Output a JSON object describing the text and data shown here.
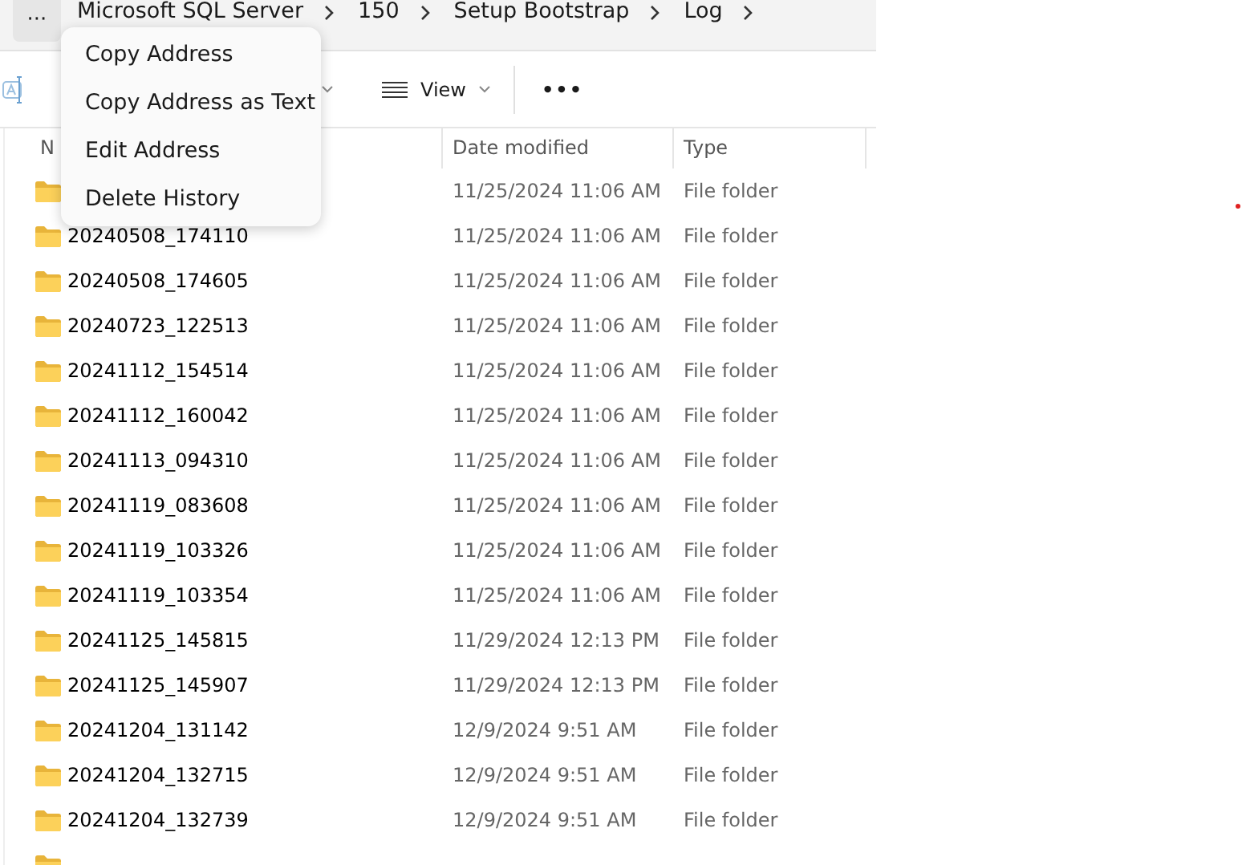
{
  "address_bar": {
    "overflow_button": "···",
    "crumbs": [
      "Microsoft SQL Server",
      "150",
      "Setup Bootstrap",
      "Log"
    ]
  },
  "toolbar": {
    "view_button": "View",
    "more_button": "•••"
  },
  "columns": [
    {
      "label": "N"
    },
    {
      "label": "Date modified"
    },
    {
      "label": "Type"
    }
  ],
  "rows": [
    {
      "date": "11/25/2024 11:06 AM",
      "type": "File folder"
    },
    {
      "name": "20240508_174110",
      "date": "11/25/2024 11:06 AM",
      "type": "File folder"
    },
    {
      "name": "20240508_174605",
      "date": "11/25/2024 11:06 AM",
      "type": "File folder"
    },
    {
      "name": "20240723_122513",
      "date": "11/25/2024 11:06 AM",
      "type": "File folder"
    },
    {
      "name": "20241112_154514",
      "date": "11/25/2024 11:06 AM",
      "type": "File folder"
    },
    {
      "name": "20241112_160042",
      "date": "11/25/2024 11:06 AM",
      "type": "File folder"
    },
    {
      "name": "20241113_094310",
      "date": "11/25/2024 11:06 AM",
      "type": "File folder"
    },
    {
      "name": "20241119_083608",
      "date": "11/25/2024 11:06 AM",
      "type": "File folder"
    },
    {
      "name": "20241119_103326",
      "date": "11/25/2024 11:06 AM",
      "type": "File folder"
    },
    {
      "name": "20241119_103354",
      "date": "11/25/2024 11:06 AM",
      "type": "File folder"
    },
    {
      "name": "20241125_145815",
      "date": "11/29/2024 12:13 PM",
      "type": "File folder"
    },
    {
      "name": "20241125_145907",
      "date": "11/29/2024 12:13 PM",
      "type": "File folder"
    },
    {
      "name": "20241204_131142",
      "date": "12/9/2024 9:51 AM",
      "type": "File folder"
    },
    {
      "name": "20241204_132715",
      "date": "12/9/2024 9:51 AM",
      "type": "File folder"
    },
    {
      "name": "20241204_132739",
      "date": "12/9/2024 9:51 AM",
      "type": "File folder"
    },
    {}
  ],
  "context_menu": [
    "Copy Address",
    "Copy Address as Text",
    "Edit Address",
    "Delete History"
  ]
}
